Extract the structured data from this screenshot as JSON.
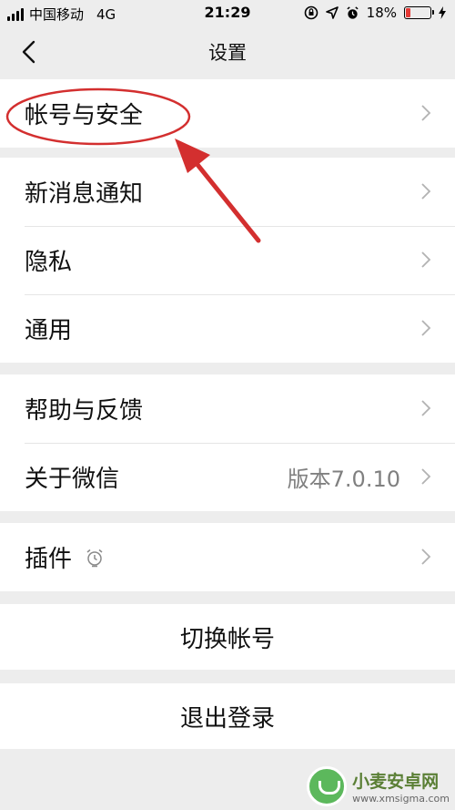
{
  "status_bar": {
    "carrier": "中国移动",
    "network": "4G",
    "time": "21:29",
    "battery_percent_text": "18%",
    "battery_level": 0.18,
    "battery_color": "#e53935"
  },
  "nav": {
    "title": "设置",
    "back_icon": "chevron-left-icon"
  },
  "sections": {
    "account": {
      "label": "帐号与安全"
    },
    "notifications": {
      "label": "新消息通知"
    },
    "privacy": {
      "label": "隐私"
    },
    "general": {
      "label": "通用"
    },
    "help": {
      "label": "帮助与反馈"
    },
    "about": {
      "label": "关于微信",
      "value": "版本7.0.10"
    },
    "plugins": {
      "label": "插件",
      "icon": "plugin-timer-icon"
    }
  },
  "actions": {
    "switch_account": "切换帐号",
    "logout": "退出登录"
  },
  "annotation": {
    "color": "#d32f2f"
  },
  "watermark": {
    "name": "小麦安卓网",
    "url": "www.xmsigma.com"
  }
}
